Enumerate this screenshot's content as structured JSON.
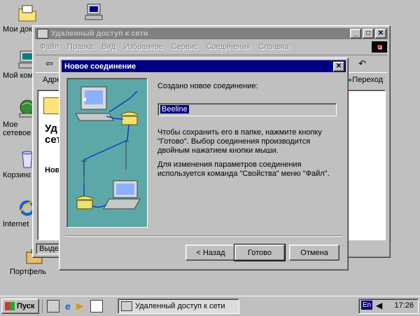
{
  "desktop": {
    "icons": [
      {
        "label": "Мои документы"
      },
      {
        "label": "Мой компьютер"
      },
      {
        "label": "Мое сетевое окружение"
      },
      {
        "label": "Корзина"
      },
      {
        "label": "Internet Explorer"
      },
      {
        "label": "Портфель"
      }
    ]
  },
  "bgwindow": {
    "title": "Удаленный доступ к сети",
    "menu": [
      "Файл",
      "Правка",
      "Вид",
      "Избранное",
      "Сервис",
      "Соединения",
      "Справка"
    ],
    "address_label": "Адрес",
    "go_label": "Переход",
    "heading_line1": "Уд",
    "heading_line2": "сет",
    "item": "Нов",
    "status": "Выдел"
  },
  "dialog": {
    "title": "Новое соединение",
    "created_label": "Создано новое соединение:",
    "connection_name": "Beeline",
    "text1": "Чтобы сохранить его в папке, нажмите кнопку \"Готово\".  Выбор соединения производится двойным нажатием кнопки мыши.",
    "text2": "Для изменения параметров соединения используется команда \"Свойства\" меню \"Файл\".",
    "back_label": "< Назад",
    "finish_label": "Готово",
    "cancel_label": "Отмена"
  },
  "taskbar": {
    "start_label": "Пуск",
    "task_label": "Удаленный доступ к сети",
    "lang": "En",
    "clock": "17:26"
  },
  "colors": {
    "desktop": "#c0c0c0",
    "title_active": "#000080",
    "title_inactive": "#808080",
    "wizard_panel": "#5ca8a8"
  }
}
